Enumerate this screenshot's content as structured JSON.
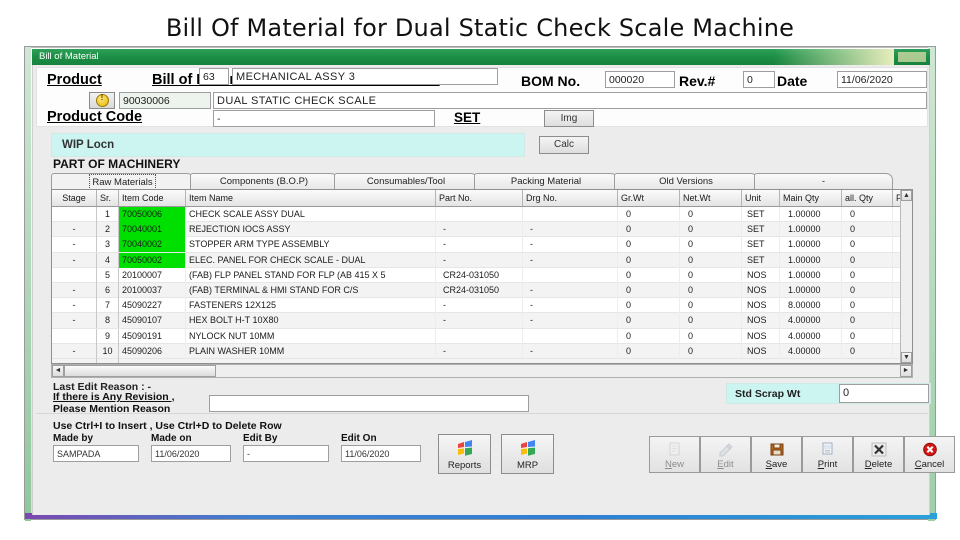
{
  "slide": {
    "title": "Bill Of Material for Dual Static Check Scale Machine"
  },
  "window": {
    "title": "Bill of Material"
  },
  "header": {
    "product_label": "Product",
    "bom_title": "Bill of Material for One Unit of Parent Item",
    "bom_no_label": "BOM No.",
    "bom_no_value": "000020",
    "rev_label": "Rev.#",
    "rev_value": "0",
    "date_label": "Date",
    "date_value": "11/06/2020",
    "product_code_value": "90030006",
    "product_name_value": "DUAL STATIC CHECK SCALE",
    "product_code_label": "Product Code",
    "product_code_field": "-",
    "set_label": "SET",
    "img_button": "Img"
  },
  "wip": {
    "label": "WIP Locn",
    "code": "63",
    "name": "MECHANICAL ASSY 3",
    "calc_button": "Calc",
    "part_of": "PART OF MACHINERY"
  },
  "tabs": [
    {
      "label": "Raw Materials",
      "selected": true
    },
    {
      "label": "Components (B.O.P)",
      "selected": false
    },
    {
      "label": "Consumables/Tool",
      "selected": false
    },
    {
      "label": "Packing Material",
      "selected": false
    },
    {
      "label": "Old Versions",
      "selected": false
    },
    {
      "label": "-",
      "selected": false
    }
  ],
  "grid": {
    "columns": [
      "Stage",
      "Sr.",
      "Item Code",
      "Item Name",
      "Part No.",
      "Drg No.",
      "Gr.Wt",
      "Net.Wt",
      "Unit",
      "Main Qty",
      "all. Qty",
      "Purpos"
    ],
    "rows": [
      {
        "stage": "",
        "sr": "1",
        "code": "70050006",
        "highlight": true,
        "name": "CHECK SCALE ASSY    DUAL",
        "part": "",
        "drg": "",
        "grwt": "0",
        "netwt": "0",
        "unit": "SET",
        "mainqty": "1.00000",
        "allqty": "0",
        "purpose": ""
      },
      {
        "stage": "-",
        "sr": "2",
        "code": "70040001",
        "highlight": true,
        "name": "REJECTION IOCS ASSY",
        "part": "-",
        "drg": "-",
        "grwt": "0",
        "netwt": "0",
        "unit": "SET",
        "mainqty": "1.00000",
        "allqty": "0",
        "purpose": "-"
      },
      {
        "stage": "-",
        "sr": "3",
        "code": "70040002",
        "highlight": true,
        "name": "STOPPER ARM TYPE ASSEMBLY",
        "part": "-",
        "drg": "-",
        "grwt": "0",
        "netwt": "0",
        "unit": "SET",
        "mainqty": "1.00000",
        "allqty": "0",
        "purpose": "-"
      },
      {
        "stage": "-",
        "sr": "4",
        "code": "70050002",
        "highlight": true,
        "name": "ELEC. PANEL FOR CHECK SCALE - DUAL",
        "part": "-",
        "drg": "-",
        "grwt": "0",
        "netwt": "0",
        "unit": "SET",
        "mainqty": "1.00000",
        "allqty": "0",
        "purpose": "-"
      },
      {
        "stage": "",
        "sr": "5",
        "code": "20100007",
        "highlight": false,
        "name": "(FAB) FLP PANEL STAND FOR FLP (AB 415 X 5",
        "part": "CR24-031050",
        "drg": "",
        "grwt": "0",
        "netwt": "0",
        "unit": "NOS",
        "mainqty": "1.00000",
        "allqty": "0",
        "purpose": ""
      },
      {
        "stage": "-",
        "sr": "6",
        "code": "20100037",
        "highlight": false,
        "name": "(FAB) TERMINAL & HMI STAND FOR C/S",
        "part": "CR24-031050",
        "drg": "-",
        "grwt": "0",
        "netwt": "0",
        "unit": "NOS",
        "mainqty": "1.00000",
        "allqty": "0",
        "purpose": "-"
      },
      {
        "stage": "-",
        "sr": "7",
        "code": "45090227",
        "highlight": false,
        "name": "FASTENERS 12X125",
        "part": "-",
        "drg": "-",
        "grwt": "0",
        "netwt": "0",
        "unit": "NOS",
        "mainqty": "8.00000",
        "allqty": "0",
        "purpose": "-"
      },
      {
        "stage": "-",
        "sr": "8",
        "code": "45090107",
        "highlight": false,
        "name": "HEX BOLT H-T 10X80",
        "part": "-",
        "drg": "-",
        "grwt": "0",
        "netwt": "0",
        "unit": "NOS",
        "mainqty": "4.00000",
        "allqty": "0",
        "purpose": "-"
      },
      {
        "stage": "",
        "sr": "9",
        "code": "45090191",
        "highlight": false,
        "name": "NYLOCK NUT 10MM",
        "part": "",
        "drg": "",
        "grwt": "0",
        "netwt": "0",
        "unit": "NOS",
        "mainqty": "4.00000",
        "allqty": "0",
        "purpose": ""
      },
      {
        "stage": "-",
        "sr": "10",
        "code": "45090206",
        "highlight": false,
        "name": "PLAIN WASHER 10MM",
        "part": "-",
        "drg": "-",
        "grwt": "0",
        "netwt": "0",
        "unit": "NOS",
        "mainqty": "4.00000",
        "allqty": "0",
        "purpose": "-"
      }
    ]
  },
  "bottom": {
    "last_edit_reason": "Last Edit Reason : -",
    "revision_note_line1": "If there is Any Revision ,",
    "revision_note_line2": "Please Mention Reason",
    "reason_value": "",
    "scrap_label": "Std Scrap Wt",
    "scrap_value": "0"
  },
  "footer": {
    "hint": "Use Ctrl+I to Insert , Use Ctrl+D to Delete Row",
    "made_by_label": "Made by",
    "made_by_value": "SAMPADA",
    "made_on_label": "Made on",
    "made_on_value": "11/06/2020",
    "edit_by_label": "Edit By",
    "edit_by_value": "-",
    "edit_on_label": "Edit On",
    "edit_on_value": "11/06/2020",
    "reports_button": "Reports",
    "mrp_button": "MRP"
  },
  "actions": [
    {
      "label": "New",
      "icon": "new-page-icon",
      "disabled": true
    },
    {
      "label": "Edit",
      "icon": "pencil-icon",
      "disabled": true
    },
    {
      "label": "Save",
      "icon": "floppy-icon",
      "disabled": false
    },
    {
      "label": "Print",
      "icon": "printer-icon",
      "disabled": false
    },
    {
      "label": "Delete",
      "icon": "x-mark-icon",
      "disabled": false
    },
    {
      "label": "Cancel",
      "icon": "cancel-icon",
      "disabled": false
    }
  ],
  "colors": {
    "title_green": "#1d8f46",
    "highlight_green": "#00e000",
    "cyan_panel": "#ccf5f2",
    "cancel_red": "#d81616"
  }
}
